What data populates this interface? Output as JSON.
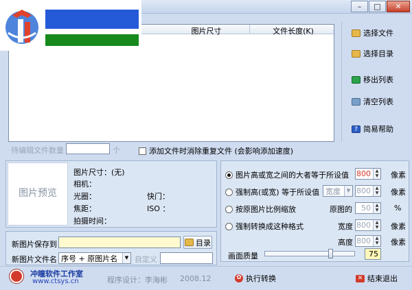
{
  "window": {
    "minimize": "–",
    "maximize": "□",
    "close": "✕"
  },
  "file_list": {
    "columns": [
      "",
      "图片尺寸",
      "文件长度(K)"
    ],
    "rows": []
  },
  "side_buttons": {
    "select_file": "选择文件",
    "select_dir": "选择目录",
    "remove_list": "移出列表",
    "clear_list": "清空列表",
    "help": "简易帮助"
  },
  "pending": {
    "label": "待编辑文件数量",
    "unit": "个",
    "dedupe_label": "添加文件时消除重复文件 (会影响添加速度)"
  },
  "preview": {
    "placeholder": "图片预览",
    "size_label": "图片尺寸：(无)",
    "camera_label": "相机：",
    "aperture_label": "光圈：",
    "shutter_label": "快门：",
    "focal_label": "焦距：",
    "iso_label": "ISO ：",
    "time_label": "拍摄时间："
  },
  "options": {
    "opt1_label": "图片高或宽之间的大者等于所设值",
    "opt1_value": "800",
    "opt1_unit": "像素",
    "opt2_label": "强制高(或宽) 等于所设值",
    "opt2_combo": "宽度",
    "opt2_value": "800",
    "opt2_unit": "像素",
    "opt3_label": "按原图片比例缩放",
    "opt3_sub": "原图的",
    "opt3_value": "50",
    "opt3_unit": "%",
    "opt4_label": "强制转换成这种格式",
    "width_label": "宽度",
    "width_value": "800",
    "width_unit": "像素",
    "height_label": "高度",
    "height_value": "800",
    "height_unit": "像素",
    "quality_label": "画面质量",
    "quality_value": "75",
    "quality_fraction": 0.75
  },
  "save": {
    "dir_label": "新图片保存到",
    "dir_value": "",
    "dir_button": "目录",
    "name_label": "新图片文件名",
    "name_combo": "序号 + 原图片名",
    "custom_label": "自定义",
    "custom_value": ""
  },
  "footer": {
    "studio": "冲瞳软件工作室",
    "site": "www.ctsys.cn",
    "designer": "程序设计：李海彬",
    "date": "2008.12",
    "run_button": "执行转换",
    "exit_button": "结束退出"
  },
  "colors": {
    "logo_blue": "#2459d8",
    "logo_green": "#168a1c",
    "accent_red": "#d23b2b",
    "quality_yellow": "#fff7b8"
  }
}
